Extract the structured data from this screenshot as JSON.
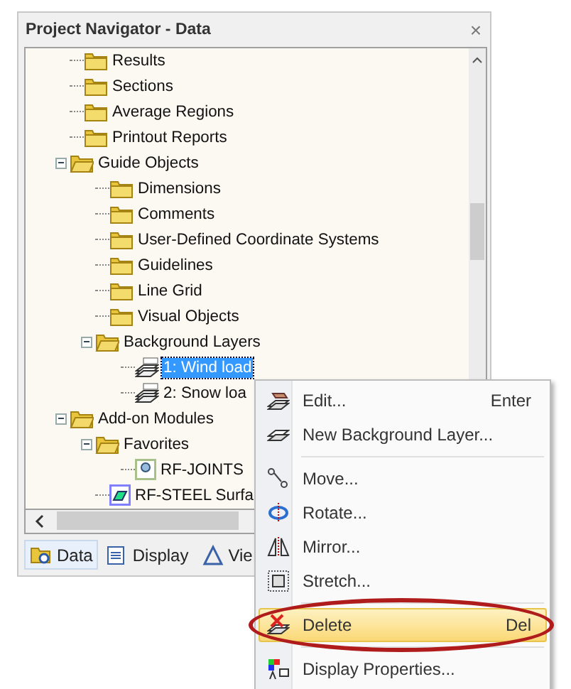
{
  "window": {
    "title": "Project Navigator - Data",
    "close": "×"
  },
  "tree": [
    {
      "label": "Results",
      "kind": "folder",
      "selected": false
    },
    {
      "label": "Sections",
      "kind": "folder",
      "selected": false
    },
    {
      "label": "Average Regions",
      "kind": "folder",
      "selected": false
    },
    {
      "label": "Printout Reports",
      "kind": "folder",
      "selected": false
    },
    {
      "label": "Guide Objects",
      "kind": "folder",
      "expanded": true,
      "selected": false,
      "children": [
        {
          "label": "Dimensions",
          "kind": "folder",
          "selected": false
        },
        {
          "label": "Comments",
          "kind": "folder",
          "selected": false
        },
        {
          "label": "User-Defined Coordinate Systems",
          "kind": "folder",
          "selected": false
        },
        {
          "label": "Guidelines",
          "kind": "folder",
          "selected": false
        },
        {
          "label": "Line Grid",
          "kind": "folder",
          "selected": false
        },
        {
          "label": "Visual Objects",
          "kind": "folder",
          "selected": false
        },
        {
          "label": "Background Layers",
          "kind": "folder",
          "expanded": true,
          "selected": false,
          "children": [
            {
              "label": "1: Wind load",
              "kind": "layer",
              "selected": true
            },
            {
              "label": "2: Snow loa",
              "kind": "layer",
              "selected": false
            }
          ]
        }
      ]
    },
    {
      "label": "Add-on Modules",
      "kind": "folder",
      "expanded": true,
      "selected": false,
      "children": [
        {
          "label": "Favorites",
          "kind": "folder",
          "expanded": true,
          "selected": false,
          "children": [
            {
              "label": "RF-JOINTS",
              "kind": "module",
              "selected": false
            }
          ]
        },
        {
          "label": "RF-STEEL Surfa",
          "kind": "module",
          "selected": false
        }
      ]
    }
  ],
  "tabs": [
    {
      "label": "Data",
      "selected": true
    },
    {
      "label": "Display",
      "selected": false
    },
    {
      "label": "Vie",
      "selected": false
    }
  ],
  "menu": [
    {
      "kind": "item",
      "label": "Edit...",
      "shortcut": "Enter",
      "selected": false
    },
    {
      "kind": "item",
      "label": "New Background Layer...",
      "selected": false
    },
    {
      "kind": "separator"
    },
    {
      "kind": "item",
      "label": "Move...",
      "selected": false
    },
    {
      "kind": "item",
      "label": "Rotate...",
      "selected": false
    },
    {
      "kind": "item",
      "label": "Mirror...",
      "selected": false
    },
    {
      "kind": "item",
      "label": "Stretch...",
      "selected": false
    },
    {
      "kind": "separator"
    },
    {
      "kind": "item",
      "label": "Delete",
      "shortcut": "Del",
      "selected": true,
      "highlighted_by_ring": true
    },
    {
      "kind": "separator"
    },
    {
      "kind": "item",
      "label": "Display Properties...",
      "selected": false
    }
  ]
}
